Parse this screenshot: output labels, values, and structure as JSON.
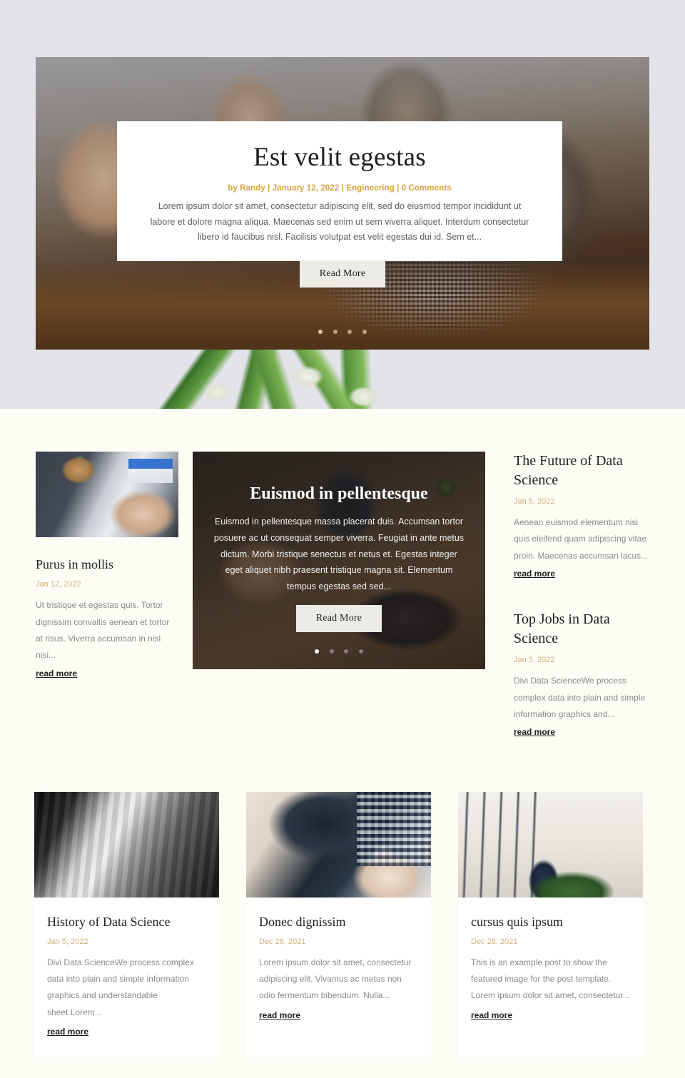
{
  "hero": {
    "title": "Est velit egestas",
    "meta": "by Randy | January 12, 2022 | Engineering | 0 Comments",
    "excerpt": "Lorem ipsum dolor sit amet, consectetur adipiscing elit, sed do eiusmod tempor incididunt ut labore et dolore magna aliqua. Maecenas sed enim ut sem viverra aliquet. Interdum consectetur libero id faucibus nisl. Facilisis volutpat est velit egestas dui id. Sem et...",
    "read_more_label": "Read More",
    "dots": [
      "1",
      "2",
      "3",
      "4"
    ],
    "active_dot": 0,
    "image_alt": "office-coworking-photo"
  },
  "left_post": {
    "title": "Purus in mollis",
    "date": "Jan 12, 2022",
    "excerpt": "Ut tristique et egestas quis. Tortor dignissim convallis aenean et tortor at risus. Viverra accumsan in nisl nisi...",
    "read_more_label": "read more",
    "image_alt": "hands-typing-on-laptop"
  },
  "slider": {
    "title": "Euismod in pellentesque",
    "excerpt": "Euismod in pellentesque massa placerat duis. Accumsan tortor posuere ac ut consequat semper viverra. Feugiat in ante metus dictum. Morbi tristique senectus et netus et. Egestas integer eget aliquet nibh praesent tristique magna sit. Elementum tempus egestas sed sed...",
    "read_more_label": "Read More",
    "dots": [
      "1",
      "2",
      "3",
      "4"
    ],
    "active_dot": 0,
    "image_alt": "person-holding-phone-at-desk"
  },
  "right_posts": [
    {
      "title": "The Future of Data Science",
      "date": "Jan 5, 2022",
      "excerpt": "Aenean euismod elementum nisi quis eleifend quam adipiscing vitae proin. Maecenas accumsan lacus...",
      "read_more_label": "read more"
    },
    {
      "title": "Top Jobs in Data Science",
      "date": "Jan 5, 2022",
      "excerpt": "Divi Data ScienceWe process complex data into plain and simple information graphics and...",
      "read_more_label": "read more"
    }
  ],
  "bottom_posts": [
    {
      "title": "History of Data Science",
      "date": "Jan 5, 2022",
      "excerpt": "Divi Data ScienceWe process complex data into plain and simple information graphics and understandable sheet.Lorem...",
      "read_more_label": "read more",
      "image_alt": "black-and-white-laptop-on-bench"
    },
    {
      "title": "Donec dignissim",
      "date": "Dec 28, 2021",
      "excerpt": "Lorem ipsum dolor sit amet, consectetur adipiscing elit. Vivamus ac metus non odio fermentum bibendum. Nulla...",
      "read_more_label": "read more",
      "image_alt": "blood-pressure-measurement"
    },
    {
      "title": "cursus quis ipsum",
      "date": "Dec 28, 2021",
      "excerpt": "This is an example post to show the featured image for the post template. Lorem ipsum dolor sit amet, consectetur...",
      "read_more_label": "read more",
      "image_alt": "security-guard-near-building"
    }
  ],
  "colors": {
    "accent_gold": "#d9a33f",
    "date_tan": "#d2b07e",
    "hero_bg": "#e3e3e9",
    "main_bg": "#fdfcf5",
    "card_bg": "#ffffff",
    "button_bg": "#ecebe6",
    "text_dark": "#1f1f1f",
    "text_muted": "#8a8a8a"
  }
}
